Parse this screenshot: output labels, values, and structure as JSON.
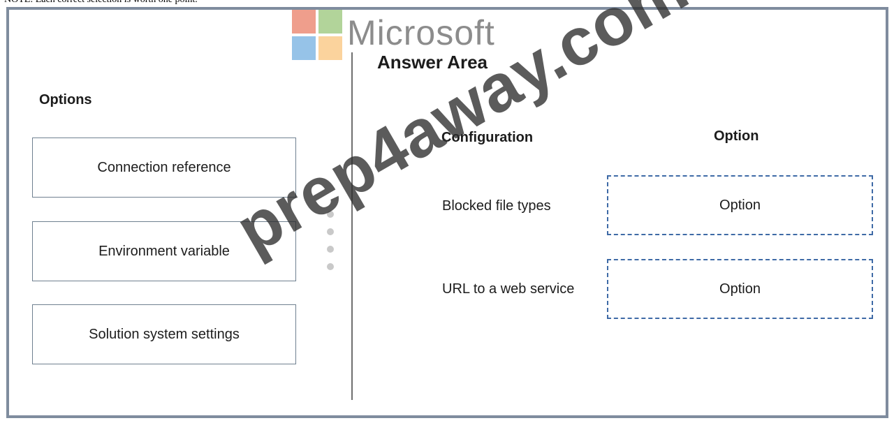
{
  "header_note": "NOTE: Each correct selection is worth one point.",
  "logo": {
    "word": "Microsoft"
  },
  "watermark": {
    "text": "prep4away.com"
  },
  "options_panel": {
    "title": "Options",
    "items": [
      {
        "label": "Connection reference"
      },
      {
        "label": "Environment variable"
      },
      {
        "label": "Solution system settings"
      }
    ]
  },
  "answer_area": {
    "title": "Answer Area",
    "column_headers": {
      "configuration": "Configuration",
      "option": "Option"
    },
    "rows": [
      {
        "configuration": "Blocked file types",
        "option": "Option"
      },
      {
        "configuration": "URL to a web service",
        "option": "Option"
      }
    ]
  },
  "colors": {
    "frame_border": "#7f8c9e",
    "target_border": "#3e6aa6",
    "watermark": "#2d2d2d"
  }
}
